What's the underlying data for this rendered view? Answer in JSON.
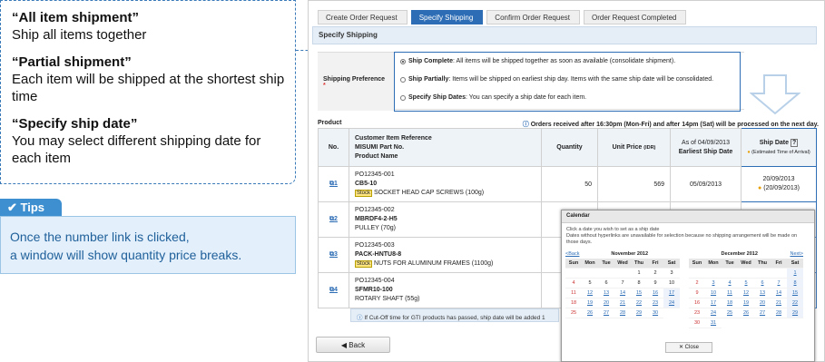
{
  "annotation": {
    "items": [
      {
        "title": "“All item shipment”",
        "desc": "Ship all items together"
      },
      {
        "title": "“Partial shipment”",
        "desc": "Each item will be shipped at the shortest ship time"
      },
      {
        "title": "“Specify ship date”",
        "desc": "You may select different shipping date for each item"
      }
    ]
  },
  "tips": {
    "label": "Tips",
    "lines": [
      "Once the number link is clicked,",
      "a window will show quantity price breaks."
    ]
  },
  "steps": [
    "Create Order Request",
    "Specify Shipping",
    "Confirm Order Request",
    "Order Request Completed"
  ],
  "section_title": "Specify Shipping",
  "pref": {
    "label": "Shipping Preference",
    "req": "*",
    "options": [
      {
        "name": "Ship Complete",
        "text": ": All items will be shipped together as soon as available (consolidate shipment)."
      },
      {
        "name": "Ship Partially",
        "text": ": Items will be shipped on earliest ship day. Items with the same ship date will be consolidated."
      },
      {
        "name": "Specify Ship Dates",
        "text": ": You can specify a ship date for each item."
      }
    ]
  },
  "product": {
    "header": "Product",
    "notice": "Orders received after 16:30pm (Mon-Fri) and after 14pm (Sat) will be processed on the next day."
  },
  "table": {
    "col_no": "No.",
    "col_ref1": "Customer Item Reference",
    "col_ref2": "MISUMI Part No.",
    "col_ref3": "Product Name",
    "col_qty": "Quantity",
    "col_price": "Unit Price",
    "col_price_unit": "(IDR)",
    "col_asof": "As of 04/09/2013",
    "col_early": "Earliest Ship Date",
    "col_ship": "Ship Date",
    "col_ship_help": "?",
    "col_ship_sub": "(Estimated Time of Arrival)",
    "rows": [
      {
        "no": "1",
        "ref": "PO12345-001",
        "part": "CB5-10",
        "stock": "Stock",
        "name": "SOCKET HEAD CAP SCREWS (100g)",
        "qty": "50",
        "price": "569",
        "early": "05/09/2013",
        "ship": "20/09/2013",
        "eta": "(20/09/2013)"
      },
      {
        "no": "2",
        "ref": "PO12345-002",
        "part": "MBRDF4-2-H5",
        "stock": "",
        "name": "PULLEY (70g)",
        "qty": "",
        "price": "",
        "early": "",
        "ship": "",
        "eta": ""
      },
      {
        "no": "3",
        "ref": "PO12345-003",
        "part": "PACK-HNTU8-8",
        "stock": "Stock",
        "name": "NUTS FOR ALUMINUM FRAMES (1100g)",
        "qty": "",
        "price": "",
        "early": "",
        "ship": "",
        "eta": ""
      },
      {
        "no": "4",
        "ref": "PO12345-004",
        "part": "SFMR10-100",
        "stock": "",
        "name": "ROTARY SHAFT (55g)",
        "qty": "",
        "price": "",
        "early": "",
        "ship": "",
        "eta": ""
      }
    ]
  },
  "note": "If Cut-Off time for GTI products has passed, ship date will be added 1",
  "back": "Back",
  "calendar": {
    "title": "Calendar",
    "text1": "Click a date you wish to set as a ship date",
    "text2": "Dates without hyperlinks are unavailable for selection because no shipping arrangement will be made on those days.",
    "prev": "<Back",
    "next": "Next>",
    "close": "Close",
    "days": [
      "Sun",
      "Mon",
      "Tue",
      "Wed",
      "Thu",
      "Fri",
      "Sat"
    ],
    "months": [
      {
        "name": "November 2012",
        "start": 4,
        "len": 30
      },
      {
        "name": "December 2012",
        "start": 6,
        "len": 31
      }
    ]
  },
  "colors": {
    "accent": "#2d6db5",
    "tips": "#3d8fd0",
    "stock": "#ffe680"
  }
}
